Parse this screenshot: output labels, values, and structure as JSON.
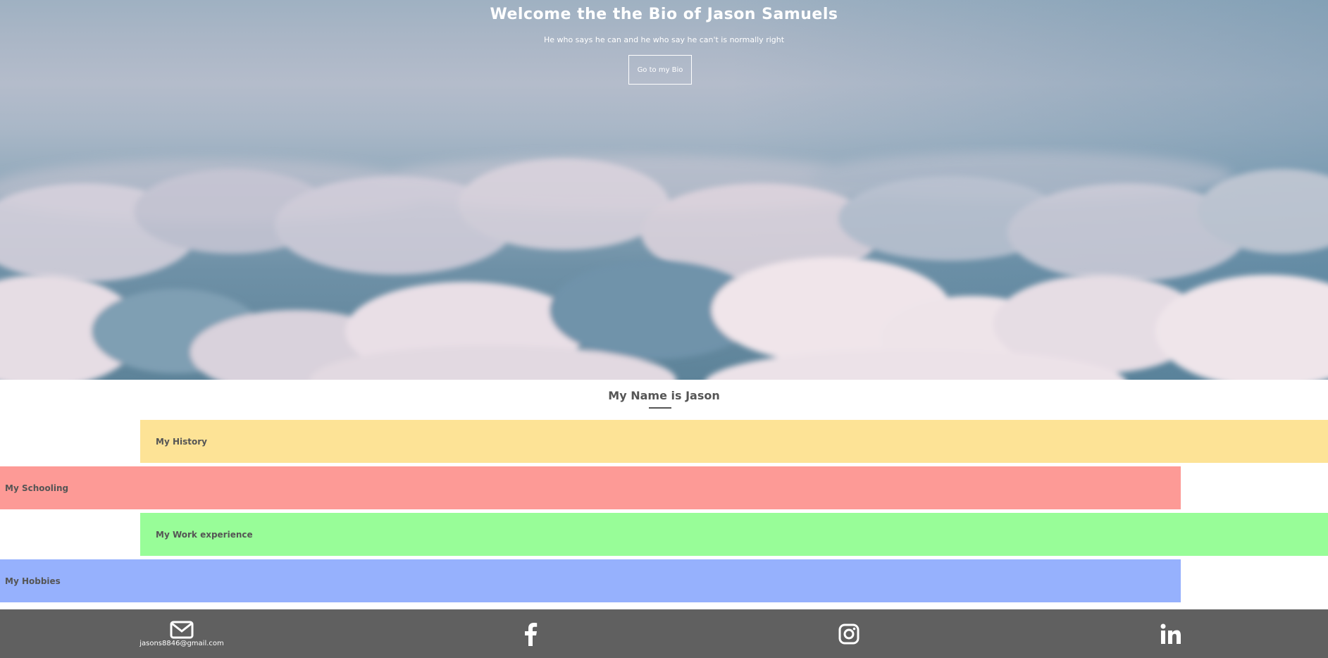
{
  "hero": {
    "title": "Welcome the the Bio of Jason Samuels",
    "subtitle": "He who says he can and he who say he can't is normally right",
    "button_label": "Go to my Bio"
  },
  "section": {
    "heading": "My Name is Jason",
    "bars": [
      {
        "label": "My History",
        "color": "#fde396"
      },
      {
        "label": "My Schooling",
        "color": "#fd9a96"
      },
      {
        "label": "My Work experience",
        "color": "#98fd98"
      },
      {
        "label": "My Hobbies",
        "color": "#96b1fd"
      }
    ]
  },
  "footer": {
    "email": "jasons8846@gmail.com",
    "icons": [
      "envelope-icon",
      "facebook-icon",
      "instagram-icon",
      "linkedin-icon"
    ],
    "background": "#606060"
  }
}
